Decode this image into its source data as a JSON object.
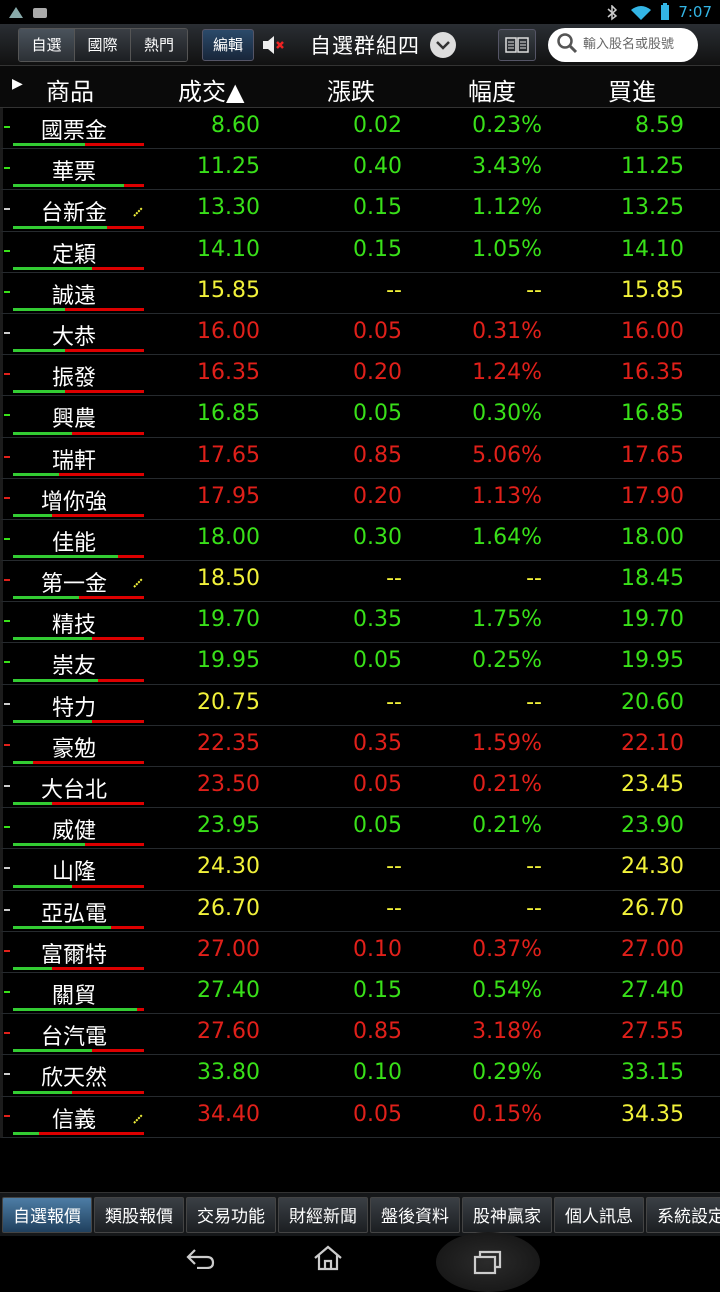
{
  "status": {
    "time": "7:07"
  },
  "toolbar": {
    "tabs": [
      "自選",
      "國際",
      "熱門"
    ],
    "edit": "編輯",
    "group_title": "自選群組四",
    "search_placeholder": "輸入股名或股號"
  },
  "columns": {
    "name": "商品",
    "price": "成交▲",
    "change": "漲跌",
    "pct": "幅度",
    "bid": "買進"
  },
  "colors": {
    "up": "#e0201a",
    "down": "#39e019",
    "flat": "#f2f23a"
  },
  "rows": [
    {
      "name": "國票金",
      "price": "8.60",
      "change": "0.02",
      "pct": "0.23%",
      "bid": "8.59",
      "pc": "g",
      "cc": "g",
      "bc": "g",
      "bar": 0.55,
      "mark": "g",
      "flag": false
    },
    {
      "name": "華票",
      "price": "11.25",
      "change": "0.40",
      "pct": "3.43%",
      "bid": "11.25",
      "pc": "g",
      "cc": "g",
      "bc": "g",
      "bar": 0.85,
      "mark": "g",
      "flag": false
    },
    {
      "name": "台新金",
      "price": "13.30",
      "change": "0.15",
      "pct": "1.12%",
      "bid": "13.25",
      "pc": "g",
      "cc": "g",
      "bc": "g",
      "bar": 0.72,
      "mark": "w",
      "flag": true
    },
    {
      "name": "定穎",
      "price": "14.10",
      "change": "0.15",
      "pct": "1.05%",
      "bid": "14.10",
      "pc": "g",
      "cc": "g",
      "bc": "g",
      "bar": 0.6,
      "mark": "g",
      "flag": false
    },
    {
      "name": "誠遠",
      "price": "15.85",
      "change": "--",
      "pct": "--",
      "bid": "15.85",
      "pc": "y",
      "cc": "y",
      "bc": "y",
      "bar": 0.4,
      "mark": "g",
      "flag": false
    },
    {
      "name": "大恭",
      "price": "16.00",
      "change": "0.05",
      "pct": "0.31%",
      "bid": "16.00",
      "pc": "r",
      "cc": "r",
      "bc": "r",
      "bar": 0.4,
      "mark": "w",
      "flag": false
    },
    {
      "name": "振發",
      "price": "16.35",
      "change": "0.20",
      "pct": "1.24%",
      "bid": "16.35",
      "pc": "r",
      "cc": "r",
      "bc": "r",
      "bar": 0.4,
      "mark": "r",
      "flag": false
    },
    {
      "name": "興農",
      "price": "16.85",
      "change": "0.05",
      "pct": "0.30%",
      "bid": "16.85",
      "pc": "g",
      "cc": "g",
      "bc": "g",
      "bar": 0.45,
      "mark": "g",
      "flag": false
    },
    {
      "name": "瑞軒",
      "price": "17.65",
      "change": "0.85",
      "pct": "5.06%",
      "bid": "17.65",
      "pc": "r",
      "cc": "r",
      "bc": "r",
      "bar": 0.35,
      "mark": "r",
      "flag": false
    },
    {
      "name": "增你強",
      "price": "17.95",
      "change": "0.20",
      "pct": "1.13%",
      "bid": "17.90",
      "pc": "r",
      "cc": "r",
      "bc": "r",
      "bar": 0.3,
      "mark": "r",
      "flag": false
    },
    {
      "name": "佳能",
      "price": "18.00",
      "change": "0.30",
      "pct": "1.64%",
      "bid": "18.00",
      "pc": "g",
      "cc": "g",
      "bc": "g",
      "bar": 0.8,
      "mark": "g",
      "flag": false
    },
    {
      "name": "第一金",
      "price": "18.50",
      "change": "--",
      "pct": "--",
      "bid": "18.45",
      "pc": "y",
      "cc": "y",
      "bc": "g",
      "bar": 0.5,
      "mark": "r",
      "flag": true
    },
    {
      "name": "精技",
      "price": "19.70",
      "change": "0.35",
      "pct": "1.75%",
      "bid": "19.70",
      "pc": "g",
      "cc": "g",
      "bc": "g",
      "bar": 0.6,
      "mark": "g",
      "flag": false
    },
    {
      "name": "崇友",
      "price": "19.95",
      "change": "0.05",
      "pct": "0.25%",
      "bid": "19.95",
      "pc": "g",
      "cc": "g",
      "bc": "g",
      "bar": 0.65,
      "mark": "g",
      "flag": false
    },
    {
      "name": "特力",
      "price": "20.75",
      "change": "--",
      "pct": "--",
      "bid": "20.60",
      "pc": "y",
      "cc": "y",
      "bc": "g",
      "bar": 0.6,
      "mark": "w",
      "flag": false
    },
    {
      "name": "豪勉",
      "price": "22.35",
      "change": "0.35",
      "pct": "1.59%",
      "bid": "22.10",
      "pc": "r",
      "cc": "r",
      "bc": "r",
      "bar": 0.15,
      "mark": "r",
      "flag": false
    },
    {
      "name": "大台北",
      "price": "23.50",
      "change": "0.05",
      "pct": "0.21%",
      "bid": "23.45",
      "pc": "r",
      "cc": "r",
      "bc": "y",
      "bar": 0.3,
      "mark": "w",
      "flag": false
    },
    {
      "name": "威健",
      "price": "23.95",
      "change": "0.05",
      "pct": "0.21%",
      "bid": "23.90",
      "pc": "g",
      "cc": "g",
      "bc": "g",
      "bar": 0.55,
      "mark": "g",
      "flag": false
    },
    {
      "name": "山隆",
      "price": "24.30",
      "change": "--",
      "pct": "--",
      "bid": "24.30",
      "pc": "y",
      "cc": "y",
      "bc": "y",
      "bar": 0.45,
      "mark": "w",
      "flag": false
    },
    {
      "name": "亞弘電",
      "price": "26.70",
      "change": "--",
      "pct": "--",
      "bid": "26.70",
      "pc": "y",
      "cc": "y",
      "bc": "y",
      "bar": 0.75,
      "mark": "w",
      "flag": false
    },
    {
      "name": "富爾特",
      "price": "27.00",
      "change": "0.10",
      "pct": "0.37%",
      "bid": "27.00",
      "pc": "r",
      "cc": "r",
      "bc": "r",
      "bar": 0.3,
      "mark": "r",
      "flag": false
    },
    {
      "name": "關貿",
      "price": "27.40",
      "change": "0.15",
      "pct": "0.54%",
      "bid": "27.40",
      "pc": "g",
      "cc": "g",
      "bc": "g",
      "bar": 0.95,
      "mark": "g",
      "flag": false
    },
    {
      "name": "台汽電",
      "price": "27.60",
      "change": "0.85",
      "pct": "3.18%",
      "bid": "27.55",
      "pc": "r",
      "cc": "r",
      "bc": "r",
      "bar": 0.6,
      "mark": "r",
      "flag": false
    },
    {
      "name": "欣天然",
      "price": "33.80",
      "change": "0.10",
      "pct": "0.29%",
      "bid": "33.15",
      "pc": "g",
      "cc": "g",
      "bc": "g",
      "bar": 0.45,
      "mark": "w",
      "flag": false
    },
    {
      "name": "信義",
      "price": "34.40",
      "change": "0.05",
      "pct": "0.15%",
      "bid": "34.35",
      "pc": "r",
      "cc": "r",
      "bc": "y",
      "bar": 0.2,
      "mark": "r",
      "flag": true
    }
  ],
  "bottom_tabs": [
    "自選報價",
    "類股報價",
    "交易功能",
    "財經新聞",
    "盤後資料",
    "股神贏家",
    "個人訊息",
    "系統設定"
  ],
  "icons": {
    "mute": "speaker-muted-icon",
    "dropdown": "chevron-down-icon",
    "book": "book-icon",
    "search": "search-icon",
    "back": "back-icon",
    "home": "home-icon",
    "recents": "recents-icon"
  }
}
